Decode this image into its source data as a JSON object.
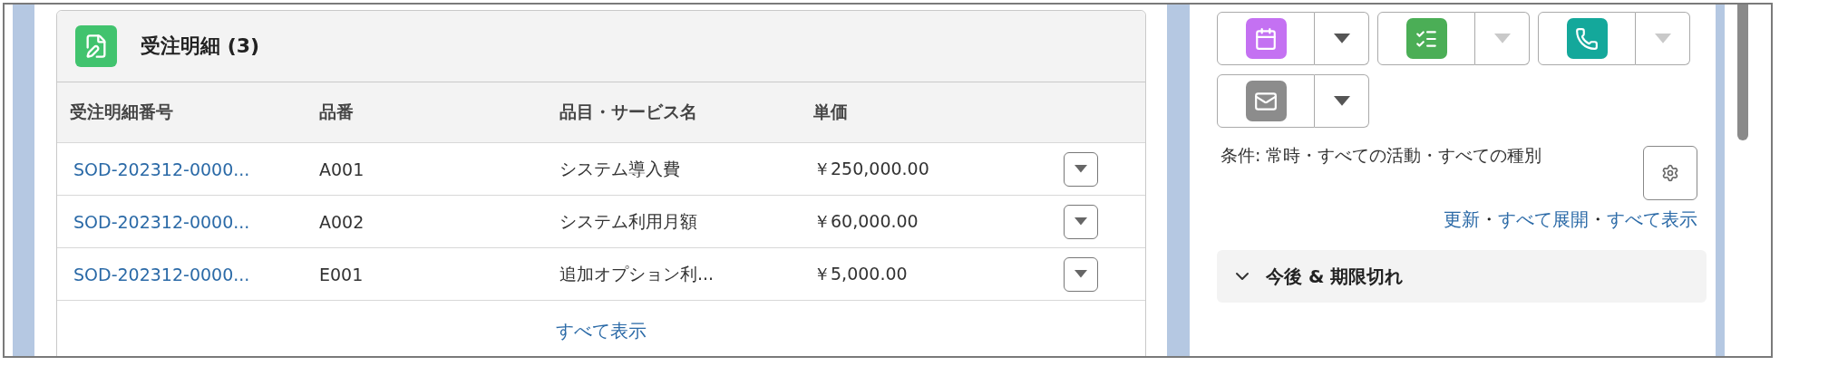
{
  "related_list": {
    "title": "受注明細 (3)",
    "columns": [
      "受注明細番号",
      "品番",
      "品目・サービス名",
      "単価"
    ],
    "rows": [
      {
        "cells": [
          "SOD-202312-0000...",
          "A001",
          "システム導入費",
          "￥250,000.00"
        ]
      },
      {
        "cells": [
          "SOD-202312-0000...",
          "A002",
          "システム利用月額",
          "￥60,000.00"
        ]
      },
      {
        "cells": [
          "SOD-202312-0000...",
          "E001",
          "追加オプション利...",
          "￥5,000.00"
        ]
      }
    ],
    "view_all": "すべて表示"
  },
  "activity": {
    "actions": [
      {
        "kind": "event",
        "color": "#c471f2",
        "dropdown_disabled": false
      },
      {
        "kind": "task",
        "color": "#4bae56",
        "dropdown_disabled": true
      },
      {
        "kind": "call",
        "color": "#14a89b",
        "dropdown_disabled": true
      },
      {
        "kind": "email",
        "color": "#8c8c8c",
        "dropdown_disabled": false
      }
    ],
    "filter": "条件: 常時・すべての活動・すべての種別",
    "links": [
      "更新",
      "すべて展開",
      "すべて表示"
    ],
    "separator": "・",
    "section": {
      "title": "今後 & 期限切れ",
      "expanded": true
    }
  }
}
